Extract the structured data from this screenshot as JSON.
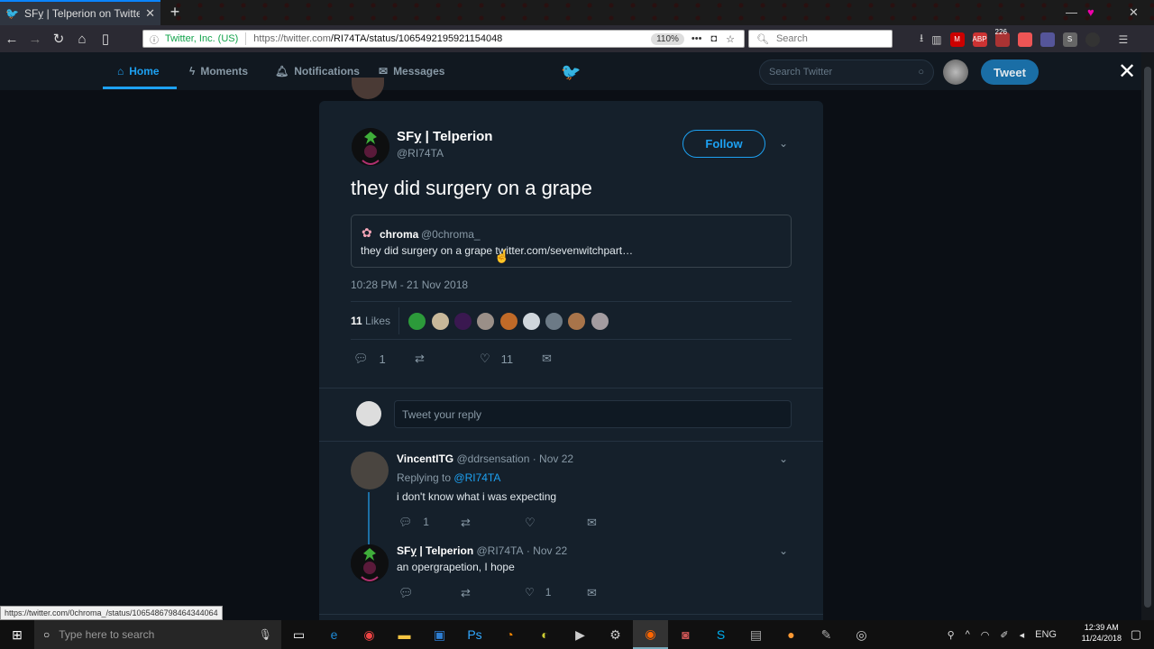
{
  "browser": {
    "tab_title": "SFỵ | Telperion on Twitter: \"the",
    "identity": "Twitter, Inc. (US)",
    "url_host": "https://twitter.com",
    "url_path": "/RI74TA/status/1065492195921154048",
    "zoom": "110%",
    "search_placeholder": "Search",
    "badge_count": "226",
    "status_url": "https://twitter.com/0chroma_/status/1065486798464344064"
  },
  "twitter_nav": {
    "home": "Home",
    "moments": "Moments",
    "notifications": "Notifications",
    "messages": "Messages",
    "search_placeholder": "Search Twitter",
    "tweet_button": "Tweet"
  },
  "tweet": {
    "author": "SFỵ | Telperion",
    "handle": "@RI74TA",
    "follow": "Follow",
    "text": "they did surgery on a grape",
    "quote": {
      "name": "chroma",
      "handle": "@0chroma_",
      "text": "they did surgery on a grape twitter.com/sevenwitchpart…"
    },
    "timestamp": "10:28 PM - 21 Nov 2018",
    "likes_count": "11",
    "likes_label": "Likes",
    "reply_count": "1",
    "like_count": "11"
  },
  "reply_box": {
    "placeholder": "Tweet your reply"
  },
  "replies": [
    {
      "name": "VincentITG",
      "handle": "@ddrsensation",
      "date": "· Nov 22",
      "replying_label": "Replying to",
      "replying_to": "@RI74TA",
      "text": "i don't know what i was expecting",
      "reply_count": "1"
    },
    {
      "name": "SFỵ | Telperion",
      "handle": "@RI74TA",
      "date": "· Nov 22",
      "text": "an opergrapetion, I hope",
      "like_count": "1"
    }
  ],
  "taskbar": {
    "search_placeholder": "Type here to search",
    "lang": "ENG",
    "time": "12:39 AM",
    "date": "11/24/2018"
  },
  "colors": {
    "accent": "#1da1f2",
    "modal_bg": "#15202b",
    "page_bg": "#0b0f15"
  }
}
